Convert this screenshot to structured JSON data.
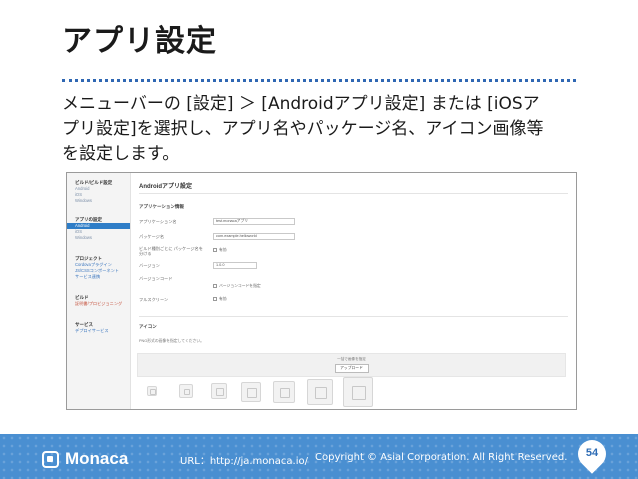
{
  "slide": {
    "title": "アプリ設定",
    "body_lines": [
      "メニューバーの [設定] ＞ [Androidアプリ設定] または [iOSア",
      "プリ設定]を選択し、アプリ名やパッケージ名、アイコン画像等",
      "を設定します。"
    ]
  },
  "screenshot": {
    "sidebar": {
      "group1_head": "ビルド/ビルド設定",
      "group1_items": [
        "Android",
        "iOS",
        "Windows"
      ],
      "group2_head": "アプリの設定",
      "group2_items": [
        "Android",
        "iOS",
        "Windows"
      ],
      "group3_head": "プロジェクト",
      "group3_items": [
        "Cordovaプラグイン",
        "JS/CSSコンポーネント",
        "サービス連携"
      ],
      "group4_head": "ビルド",
      "group4_items": [
        "証明書/プロビジョニング"
      ],
      "group5_head": "サービス",
      "group5_items": [
        "デプロイサービス"
      ]
    },
    "main": {
      "title": "Androidアプリ設定",
      "section_app_info": "アプリケーション情報",
      "label_app_name": "アプリケーション名",
      "value_app_name": "test.monacaアプリ",
      "label_package": "パッケージ名",
      "value_package": "com.example.helloworld",
      "label_build_package": "ビルド種別ごとに パッケージ名を分ける",
      "check_enable": "有効",
      "label_version": "バージョン",
      "value_version": "1.0.0",
      "label_version_code": "バージョンコード",
      "check_version_code": "バージョンコードを指定",
      "label_fullscreen": "フルスクリーン",
      "check_fullscreen": "有効",
      "section_icon": "アイコン",
      "icon_hint": "PNG形式の画像を指定してください。",
      "drop_label": "一括で画像を指定",
      "upload_button": "アップロード"
    }
  },
  "footer": {
    "logo_text": "Monaca",
    "url": "URL：http://ja.monaca.io/",
    "copyright": "Copyright © Asial Corporation. All Right Reserved.",
    "page_number": "54"
  },
  "colors": {
    "accent": "#4a8fd1",
    "rule": "#2f67b3",
    "sidebar_active": "#2e7dc7"
  }
}
